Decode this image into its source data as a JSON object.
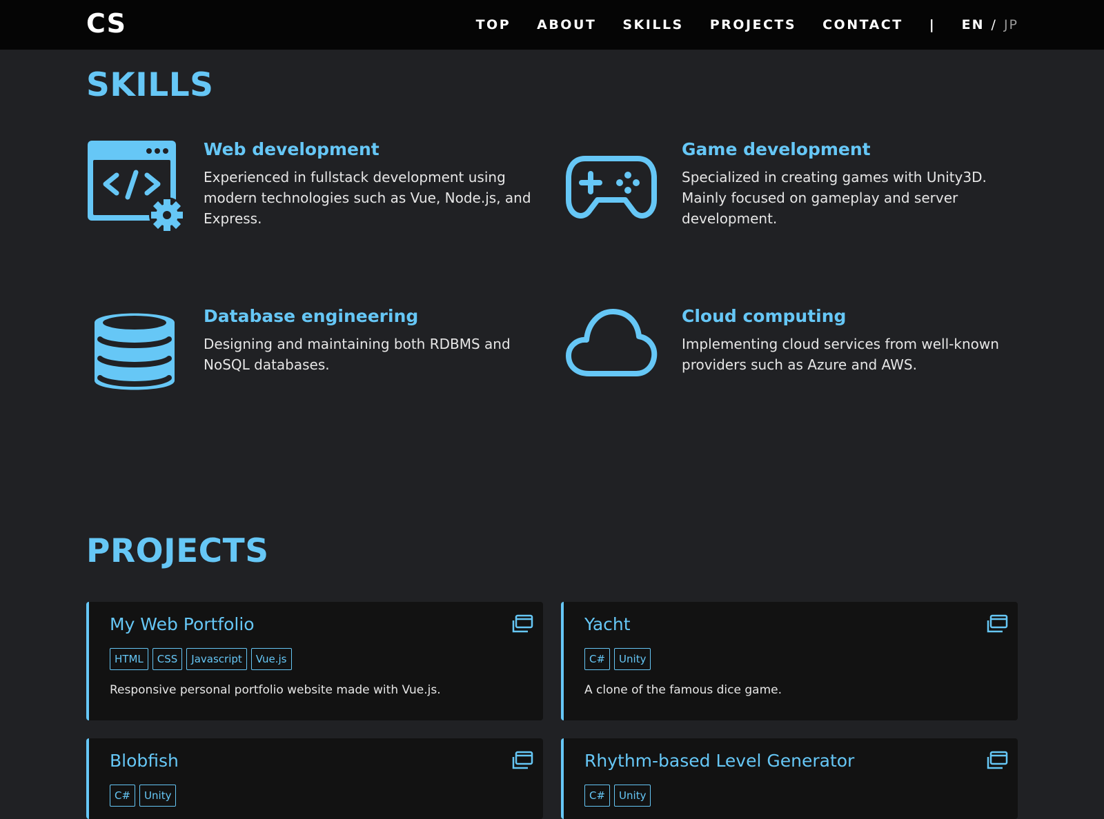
{
  "colors": {
    "accent": "#66c7f6",
    "navbar_bg": "#050505",
    "page_bg": "#202124",
    "card_bg": "#121212"
  },
  "header": {
    "logo": "CS",
    "nav": [
      "TOP",
      "ABOUT",
      "SKILLS",
      "PROJECTS",
      "CONTACT"
    ],
    "separator": "|",
    "lang_en": "EN",
    "lang_slash": "/",
    "lang_jp": "JP"
  },
  "skills": {
    "title": "SKILLS",
    "items": [
      {
        "icon": "code-window-gear-icon",
        "name": "Web development",
        "desc": "Experienced in fullstack development using modern technologies such as Vue, Node.js, and Express."
      },
      {
        "icon": "gamepad-icon",
        "name": "Game development",
        "desc": "Specialized in creating games with Unity3D. Mainly focused on gameplay and server development."
      },
      {
        "icon": "database-icon",
        "name": "Database engineering",
        "desc": "Designing and maintaining both RDBMS and NoSQL databases."
      },
      {
        "icon": "cloud-icon",
        "name": "Cloud computing",
        "desc": "Implementing cloud services from well-known providers such as Azure and AWS."
      }
    ]
  },
  "projects": {
    "title": "PROJECTS",
    "items": [
      {
        "title": "My Web Portfolio",
        "tags": [
          "HTML",
          "CSS",
          "Javascript",
          "Vue.js"
        ],
        "desc": "Responsive personal portfolio website made with Vue.js.",
        "icon": "open-in-new-window-icon"
      },
      {
        "title": "Yacht",
        "tags": [
          "C#",
          "Unity"
        ],
        "desc": "A clone of the famous dice game.",
        "icon": "open-in-new-window-icon"
      },
      {
        "title": "Blobfish",
        "tags": [
          "C#",
          "Unity"
        ],
        "desc": "",
        "icon": "open-in-new-window-icon"
      },
      {
        "title": "Rhythm-based Level Generator",
        "tags": [
          "C#",
          "Unity"
        ],
        "desc": "",
        "icon": "open-in-new-window-icon"
      }
    ]
  }
}
